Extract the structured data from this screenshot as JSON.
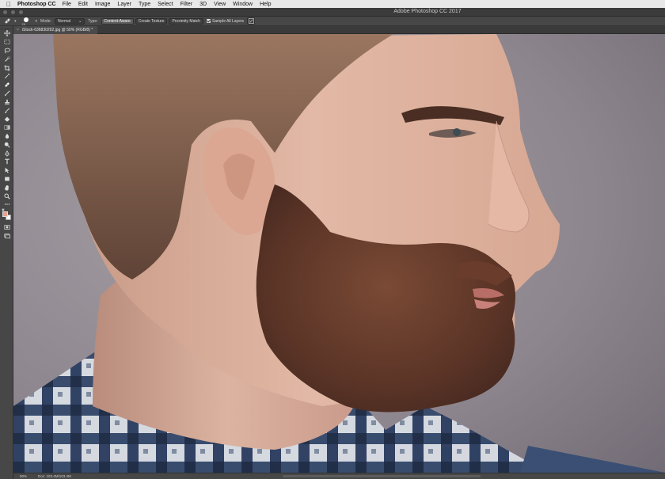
{
  "menubar": {
    "app_name": "Photoshop CC",
    "items": [
      "File",
      "Edit",
      "Image",
      "Layer",
      "Type",
      "Select",
      "Filter",
      "3D",
      "View",
      "Window",
      "Help"
    ]
  },
  "window": {
    "title": "Adobe Photoshop CC 2017"
  },
  "options": {
    "brush_size": "25",
    "mode_label": "Mode:",
    "mode_value": "Normal",
    "type_label": "Type:",
    "type_buttons": [
      "Content-Aware",
      "Create Texture",
      "Proximity Match"
    ],
    "active_type": "Content-Aware",
    "sample_all_layers_label": "Sample All Layers",
    "sample_all_layers_checked": true
  },
  "document": {
    "tab_title": "iStock-636830292.jpg @ 50% (RGB/8) *",
    "zoom": "50%",
    "doc_info": "Doc: 103.4M/103.4M"
  },
  "colors": {
    "foreground": "#e9a08e",
    "background": "#ffffff"
  },
  "tools": [
    "move-icon",
    "marquee-icon",
    "lasso-icon",
    "quick-select-icon",
    "crop-icon",
    "eyedropper-icon",
    "spot-healing-icon",
    "brush-icon",
    "clone-stamp-icon",
    "history-brush-icon",
    "eraser-icon",
    "gradient-icon",
    "blur-icon",
    "dodge-icon",
    "pen-icon",
    "type-icon",
    "path-select-icon",
    "shape-icon",
    "hand-icon",
    "zoom-icon",
    "more-tools-icon"
  ]
}
